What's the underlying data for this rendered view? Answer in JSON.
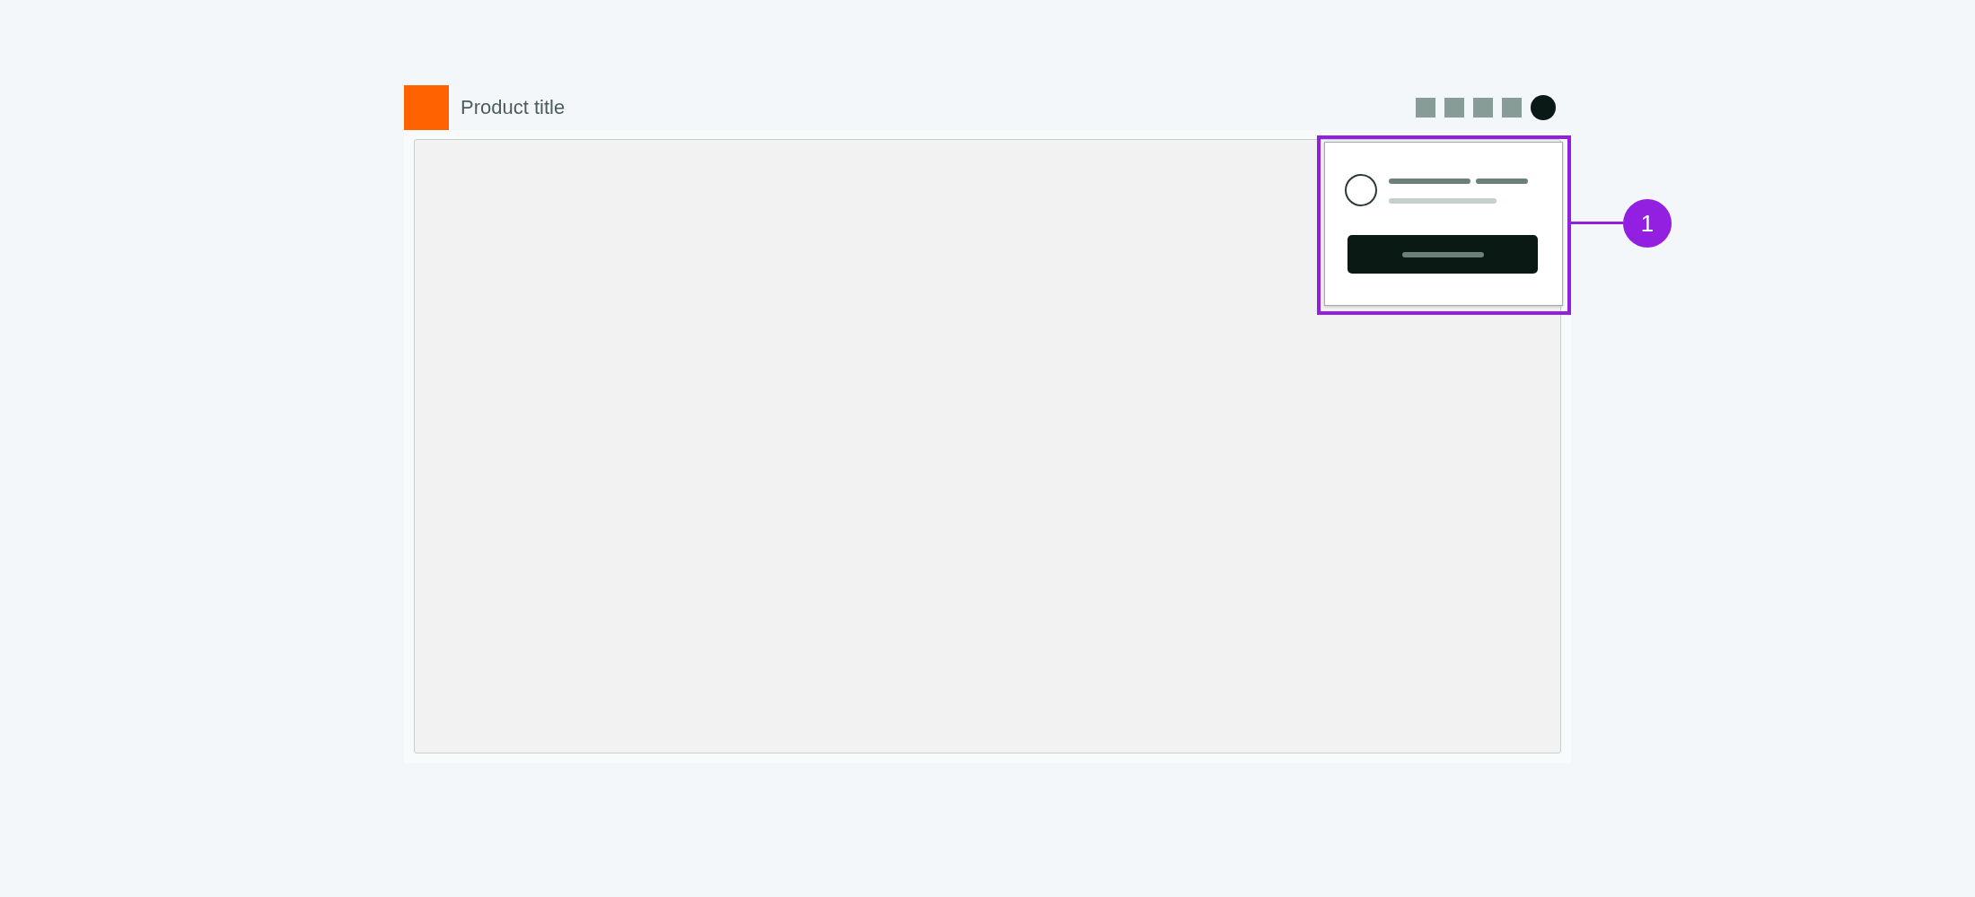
{
  "header": {
    "title": "Product title"
  },
  "callout": {
    "number": "1"
  }
}
